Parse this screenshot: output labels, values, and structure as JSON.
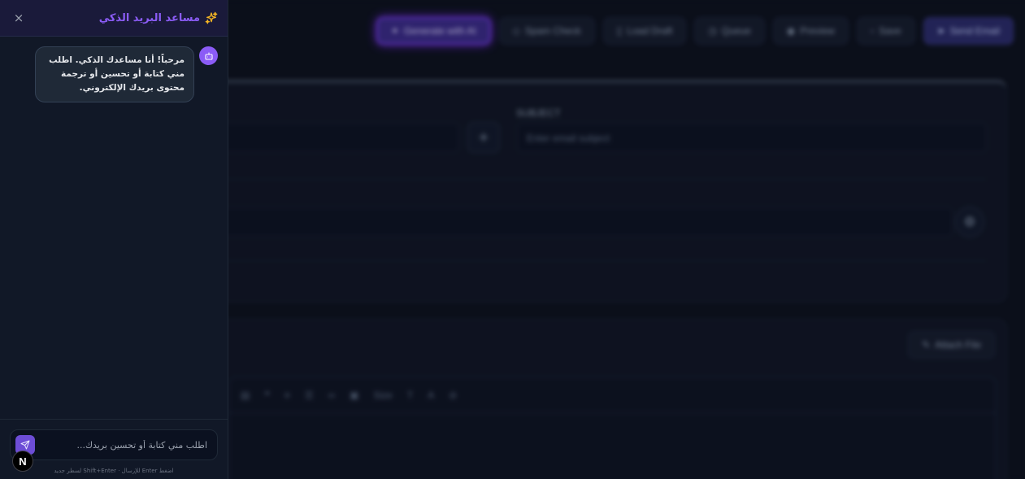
{
  "background": {
    "toolbar": [
      {
        "label": "Generate with AI",
        "style": "glow"
      },
      {
        "label": "Spam Check",
        "style": "normal"
      },
      {
        "label": "Load Draft",
        "style": "normal"
      },
      {
        "label": "Queue",
        "style": "normal"
      },
      {
        "label": "Preview",
        "style": "normal"
      },
      {
        "label": "Save",
        "style": "normal"
      },
      {
        "label": "Send Email",
        "style": "primary"
      }
    ],
    "subject_label": "SUBJECT",
    "subject_placeholder": "Enter email subject",
    "attach_label": "Attach File",
    "editor_size_label": "Size"
  },
  "assistant": {
    "title": "مساعد البريد الذكي",
    "close_label": "×",
    "welcome_message": "مرحباً! أنا مساعدك الذكي. اطلب مني كتابة أو تحسين أو ترجمة محتوى بريدك الإلكتروني.",
    "input_placeholder": "اطلب مني كتابة أو تحسين بريدك...",
    "hint": "اضغط Enter للإرسال · Shift+Enter لسطر جديد",
    "badge": "N",
    "accent_color": "#8b5cf6"
  }
}
